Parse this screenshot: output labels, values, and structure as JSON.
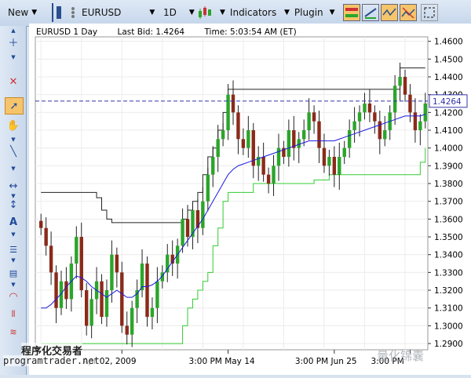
{
  "toolbar": {
    "new_label": "New",
    "symbol": "EURUSD",
    "timeframe": "1D",
    "indicators_label": "Indicators",
    "plugin_label": "Plugin"
  },
  "chart": {
    "title_symbol": "EURUSD  1 Day",
    "last_bid": "Last Bid: 1.4264",
    "time": "Time: 5:03:54 AM (ET)",
    "price_label": "1.4264"
  },
  "colors": {
    "up_candle": "#2ba52b",
    "down_candle": "#8b2a1a",
    "ma_line": "#1a1ae0",
    "channel_line": "#222222",
    "trail_line": "#33cc33",
    "bid_line": "#3333aa"
  },
  "chart_data": {
    "type": "candlestick",
    "x_tick_labels": [
      "Apr 02, 2009",
      "3:00 PM May 14",
      "3:00 PM Jun 25",
      "3:00 PM"
    ],
    "y_tick_labels": [
      "1.4600",
      "1.4500",
      "1.4400",
      "1.4300",
      "1.4200",
      "1.4100",
      "1.4000",
      "1.3900",
      "1.3800",
      "1.3700",
      "1.3600",
      "1.3500",
      "1.3400",
      "1.3300",
      "1.3200",
      "1.3100",
      "1.3000",
      "1.2900"
    ],
    "ylim": [
      1.2865,
      1.4625
    ],
    "last_bid": 1.4264,
    "closes": [
      1.355,
      1.345,
      1.33,
      1.31,
      1.325,
      1.315,
      1.335,
      1.35,
      1.32,
      1.3,
      1.315,
      1.325,
      1.305,
      1.32,
      1.34,
      1.33,
      1.3,
      1.295,
      1.31,
      1.32,
      1.335,
      1.305,
      1.31,
      1.325,
      1.33,
      1.34,
      1.335,
      1.345,
      1.36,
      1.35,
      1.365,
      1.355,
      1.37,
      1.385,
      1.395,
      1.405,
      1.41,
      1.43,
      1.42,
      1.405,
      1.4,
      1.41,
      1.39,
      1.395,
      1.385,
      1.38,
      1.39,
      1.4,
      1.395,
      1.41,
      1.4,
      1.405,
      1.41,
      1.42,
      1.415,
      1.4,
      1.39,
      1.395,
      1.385,
      1.395,
      1.4,
      1.41,
      1.415,
      1.42,
      1.425,
      1.42,
      1.415,
      1.405,
      1.41,
      1.42,
      1.435,
      1.44,
      1.43,
      1.42,
      1.41,
      1.415,
      1.425
    ],
    "ma_values": [
      1.31,
      1.31,
      1.312,
      1.315,
      1.318,
      1.322,
      1.325,
      1.328,
      1.327,
      1.325,
      1.322,
      1.32,
      1.318,
      1.316,
      1.318,
      1.32,
      1.318,
      1.316,
      1.316,
      1.318,
      1.322,
      1.322,
      1.323,
      1.325,
      1.328,
      1.332,
      1.336,
      1.34,
      1.344,
      1.348,
      1.352,
      1.356,
      1.36,
      1.365,
      1.37,
      1.375,
      1.38,
      1.385,
      1.388,
      1.39,
      1.391,
      1.392,
      1.393,
      1.394,
      1.395,
      1.396,
      1.397,
      1.398,
      1.399,
      1.4,
      1.401,
      1.402,
      1.403,
      1.404,
      1.404,
      1.404,
      1.404,
      1.404,
      1.404,
      1.405,
      1.406,
      1.407,
      1.408,
      1.409,
      1.41,
      1.411,
      1.412,
      1.413,
      1.414,
      1.415,
      1.416,
      1.417,
      1.418,
      1.418,
      1.418,
      1.418,
      1.419
    ],
    "upper_channel": [
      1.375,
      1.375,
      1.375,
      1.375,
      1.375,
      1.375,
      1.375,
      1.375,
      1.375,
      1.375,
      1.375,
      1.372,
      1.365,
      1.36,
      1.358,
      1.358,
      1.358,
      1.358,
      1.358,
      1.358,
      1.358,
      1.358,
      1.358,
      1.358,
      1.358,
      1.358,
      1.358,
      1.358,
      1.36,
      1.365,
      1.37,
      1.375,
      1.385,
      1.395,
      1.4,
      1.41,
      1.42,
      1.433,
      1.433,
      1.433,
      1.433,
      1.433,
      1.433,
      1.433,
      1.433,
      1.433,
      1.433,
      1.433,
      1.433,
      1.433,
      1.433,
      1.433,
      1.433,
      1.433,
      1.433,
      1.433,
      1.433,
      1.433,
      1.433,
      1.433,
      1.433,
      1.433,
      1.433,
      1.433,
      1.433,
      1.433,
      1.433,
      1.433,
      1.433,
      1.433,
      1.433,
      1.445,
      1.445,
      1.445,
      1.445,
      1.445,
      1.445
    ],
    "lower_trail": [
      1.29,
      1.29,
      1.29,
      1.29,
      1.29,
      1.29,
      1.29,
      1.29,
      1.29,
      1.29,
      1.29,
      1.29,
      1.29,
      1.29,
      1.29,
      1.29,
      1.29,
      1.29,
      1.29,
      1.29,
      1.29,
      1.29,
      1.29,
      1.29,
      1.29,
      1.29,
      1.29,
      1.29,
      1.3,
      1.31,
      1.315,
      1.32,
      1.325,
      1.33,
      1.345,
      1.355,
      1.37,
      1.375,
      1.375,
      1.375,
      1.375,
      1.375,
      1.38,
      1.38,
      1.38,
      1.38,
      1.38,
      1.38,
      1.38,
      1.38,
      1.38,
      1.38,
      1.38,
      1.38,
      1.382,
      1.382,
      1.382,
      1.385,
      1.385,
      1.385,
      1.385,
      1.385,
      1.385,
      1.385,
      1.385,
      1.385,
      1.385,
      1.385,
      1.385,
      1.385,
      1.385,
      1.385,
      1.385,
      1.385,
      1.385,
      1.392,
      1.4
    ]
  },
  "watermark": {
    "cn": "程序化交易者",
    "url": "programtrader.net",
    "brand": "量化锦囊"
  }
}
